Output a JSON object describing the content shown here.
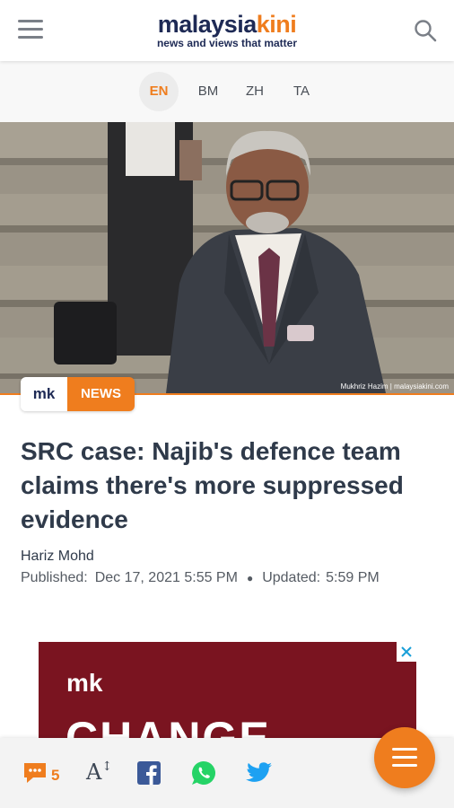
{
  "header": {
    "logo_part1": "malaysia",
    "logo_part2": "kini",
    "tagline": "news and views that matter"
  },
  "languages": [
    {
      "label": "EN",
      "active": true
    },
    {
      "label": "BM",
      "active": false
    },
    {
      "label": "ZH",
      "active": false
    },
    {
      "label": "TA",
      "active": false
    }
  ],
  "hero": {
    "caption": "Mukhriz Hazim | malaysiakini.com"
  },
  "badge": {
    "logo": "mk",
    "category": "NEWS"
  },
  "article": {
    "headline": "SRC case: Najib's defence team claims there's more suppressed evidence",
    "author": "Hariz Mohd",
    "published_label": "Published:",
    "published_value": "Dec 17, 2021 5:55 PM",
    "updated_label": "Updated:",
    "updated_value": "5:59 PM"
  },
  "ad": {
    "logo": "mk",
    "text": "CHANGE"
  },
  "bottombar": {
    "comment_count": "5",
    "font_size_label": "A"
  },
  "colors": {
    "accent": "#ef7d1e",
    "navy": "#1e2a55",
    "ad_bg": "#7a1420",
    "facebook": "#3b5998",
    "whatsapp": "#25d366",
    "twitter": "#1da1f2"
  }
}
